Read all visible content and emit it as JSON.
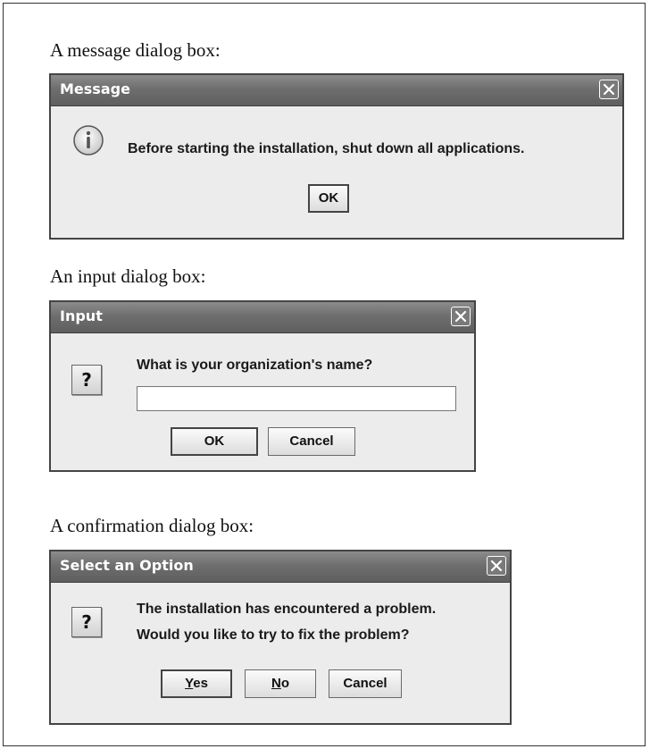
{
  "captions": {
    "message": "A message dialog box:",
    "input": "An input dialog box:",
    "confirm": "A confirmation dialog box:"
  },
  "message_dialog": {
    "title": "Message",
    "icon": "information-icon",
    "text": "Before starting the installation, shut down all applications.",
    "ok_label": "OK"
  },
  "input_dialog": {
    "title": "Input",
    "icon": "question-icon",
    "icon_glyph": "?",
    "prompt": "What is your organization's name?",
    "field_value": "",
    "ok_label": "OK",
    "cancel_label": "Cancel"
  },
  "confirm_dialog": {
    "title": "Select an Option",
    "icon": "question-icon",
    "icon_glyph": "?",
    "line1": "The installation has encountered a problem.",
    "line2": "Would you like to try to fix the problem?",
    "yes_mnemonic": "Y",
    "yes_rest": "es",
    "no_mnemonic": "N",
    "no_rest": "o",
    "cancel_label": "Cancel"
  }
}
